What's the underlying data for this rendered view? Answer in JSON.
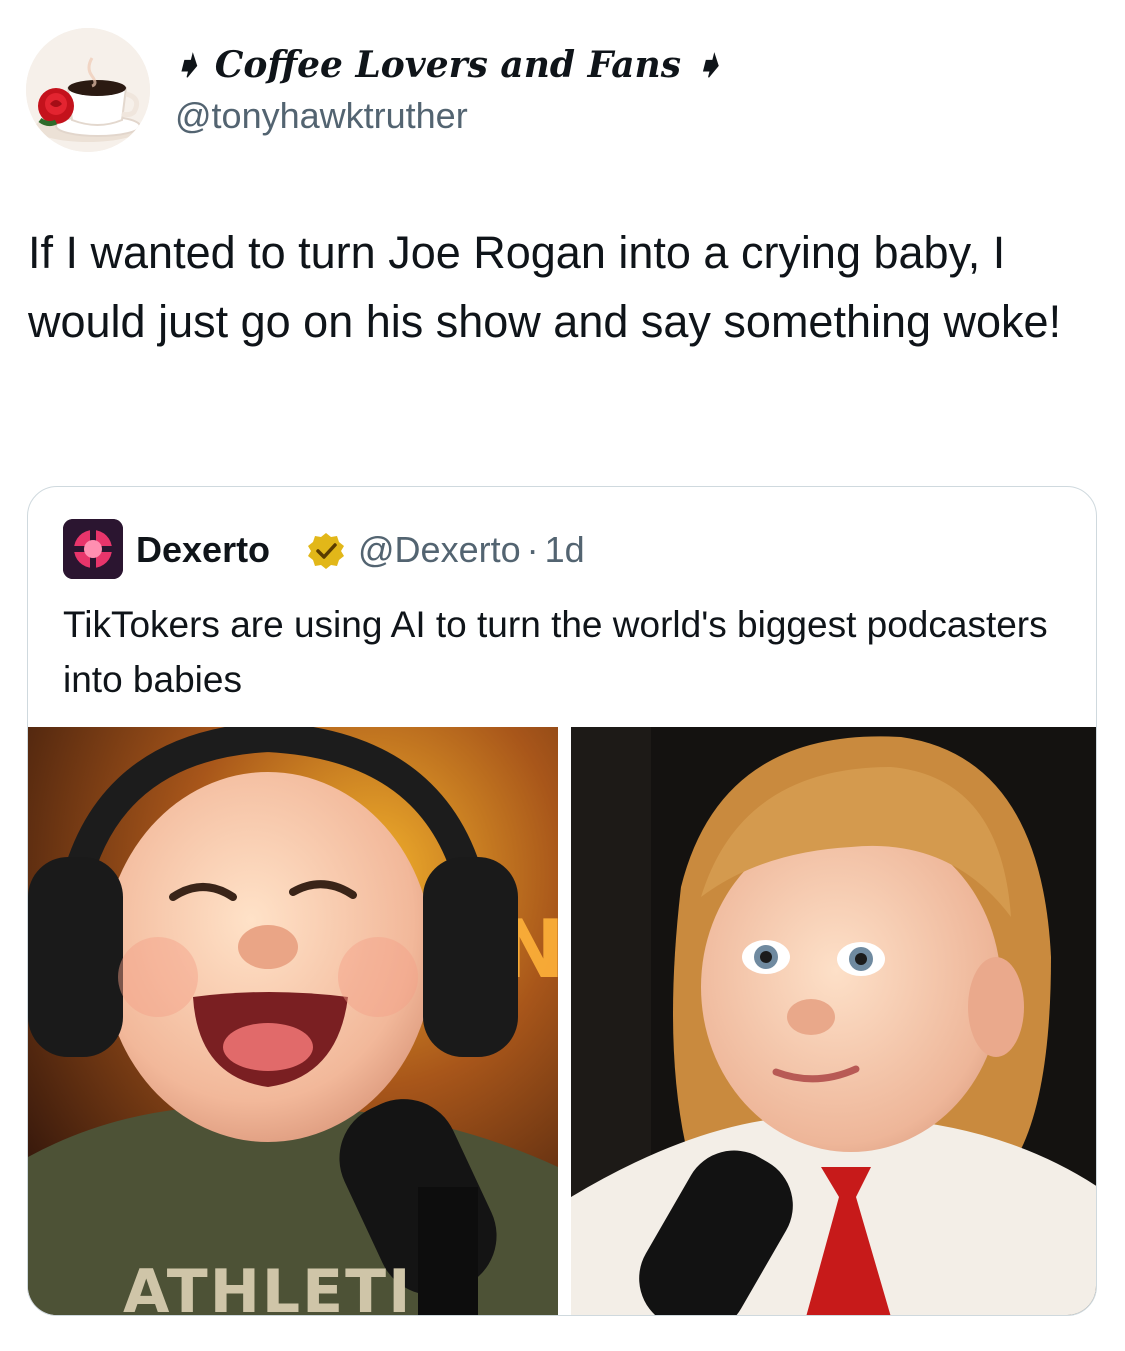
{
  "tweet": {
    "author": {
      "display_name": "➧ Coffee Lovers and Fans ➧",
      "handle": "@tonyhawktruther",
      "avatar_icon": "coffee-cup-rose-icon"
    },
    "text": "If I wanted to turn Joe Rogan into a crying baby, I would just go on his show and say something woke!"
  },
  "quote": {
    "author": {
      "display_name": "Dexerto",
      "verified_icon": "gold-verified-badge-icon",
      "handle": "@Dexerto",
      "separator": "·",
      "age": "1d",
      "avatar_icon": "dexerto-logo-icon"
    },
    "text": "TikTokers are using AI to turn the world's biggest podcasters into babies",
    "images": [
      {
        "alt_icon": "laughing-baby-headphones-icon",
        "shirt_text": "ATHLETI",
        "sign_text": "N"
      },
      {
        "alt_icon": "toddler-red-tie-icon"
      }
    ]
  },
  "colors": {
    "text_primary": "#0f1419",
    "text_secondary": "#536471",
    "border": "#cfd9de",
    "verified_gold": "#e2b719"
  }
}
